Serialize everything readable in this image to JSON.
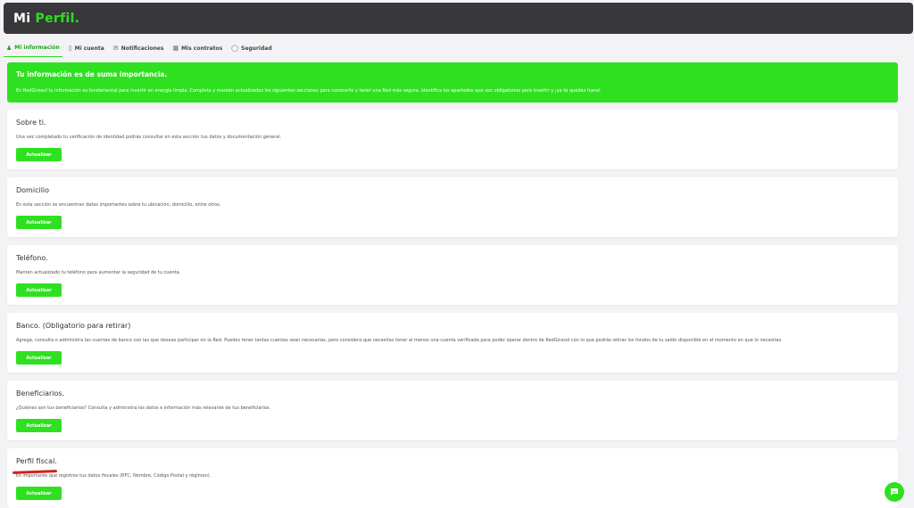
{
  "header": {
    "logo_mi": "Mi ",
    "logo_perfil": "Perfil",
    "logo_dot": "."
  },
  "tabs": [
    {
      "label": "Mi información",
      "icon": "user-icon"
    },
    {
      "label": "Mi cuenta",
      "icon": "bookmark-icon"
    },
    {
      "label": "Notificaciones",
      "icon": "mail-icon"
    },
    {
      "label": "Mis contratos",
      "icon": "calendar-icon"
    },
    {
      "label": "Seguridad",
      "icon": "shield-icon"
    }
  ],
  "banner": {
    "title": "Tu información es de suma importancia.",
    "text": "En RedGirasol tu información es fundamental para invertir en energía limpia. Completa y mantén actualizados los siguientes secciones para conocerte y tener una Red más segura. Identifica los apartados que son obligatorios para invertir y ¡ya te quedas fuera!"
  },
  "cards": [
    {
      "title": "Sobre ti.",
      "desc": "Una vez completado tu verificación de identidad podrás consultar en esta sección tus datos y documentación general.",
      "button": "Actualizar"
    },
    {
      "title": "Domicilio",
      "desc": "En esta sección se encuentran datos importantes sobre tu ubicación, domicilio, entre otros.",
      "button": "Actualizar"
    },
    {
      "title": "Teléfono.",
      "desc": "Mantén actualizado tu teléfono para aumentar la seguridad de tu cuenta.",
      "button": "Actualizar"
    },
    {
      "title": "Banco. (Obligatorio para retirar)",
      "desc": "Agrega, consulta o administra las cuentas de banco con las que deseas participar en la Red. Puedes tener tantas cuentas sean necesarias, pero considera que necesitas tener al menos una cuenta verificada para poder operar dentro de RedGirasol con lo que podrás retirar los fondos de tu saldo disponible en el momento en que lo necesites.",
      "button": "Actualizar"
    },
    {
      "title": "Beneficiarios.",
      "desc": "¿Quiénes son tus beneficiarios? Consulta y administra los datos e información más relevante de tus beneficiarios.",
      "button": "Actualizar"
    },
    {
      "title": "Perfil fiscal.",
      "desc": "Es importante que registres tus datos fiscales (RFC, Nombre, Código Postal y régimen).",
      "button": "Actualizar"
    }
  ],
  "colors": {
    "accent": "#2fe021",
    "header_bg": "#38383b",
    "annotation": "#d31f1f"
  },
  "chat": {
    "icon": "chat-icon"
  }
}
